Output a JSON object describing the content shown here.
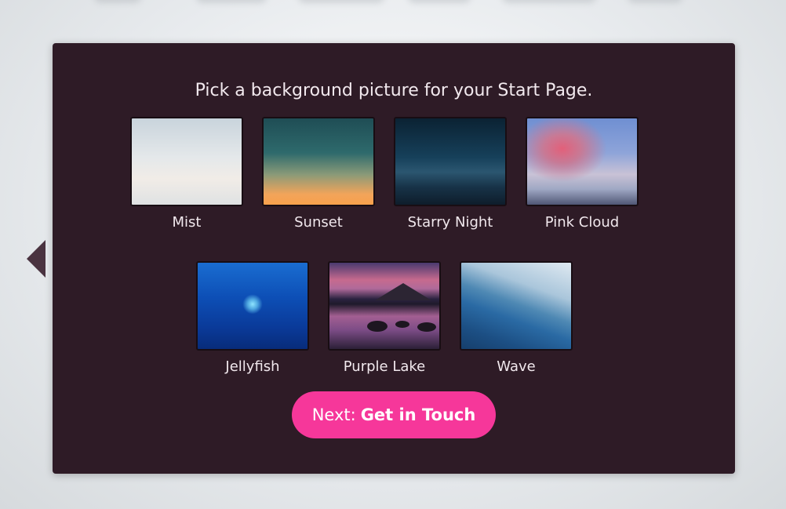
{
  "onboarding": {
    "heading": "Pick a background picture for your Start Page.",
    "backgrounds": [
      {
        "label": "Mist",
        "icon": "mist-thumbnail"
      },
      {
        "label": "Sunset",
        "icon": "sunset-thumbnail"
      },
      {
        "label": "Starry Night",
        "icon": "starry-night-thumbnail"
      },
      {
        "label": "Pink Cloud",
        "icon": "pink-cloud-thumbnail"
      },
      {
        "label": "Jellyfish",
        "icon": "jellyfish-thumbnail"
      },
      {
        "label": "Purple Lake",
        "icon": "purple-lake-thumbnail"
      },
      {
        "label": "Wave",
        "icon": "wave-thumbnail"
      }
    ],
    "next_button": {
      "prefix": "Next:",
      "target": "Get in Touch"
    },
    "colors": {
      "panel": "#2e1b26",
      "accent": "#f6379a",
      "arrow": "#4a3340"
    }
  }
}
